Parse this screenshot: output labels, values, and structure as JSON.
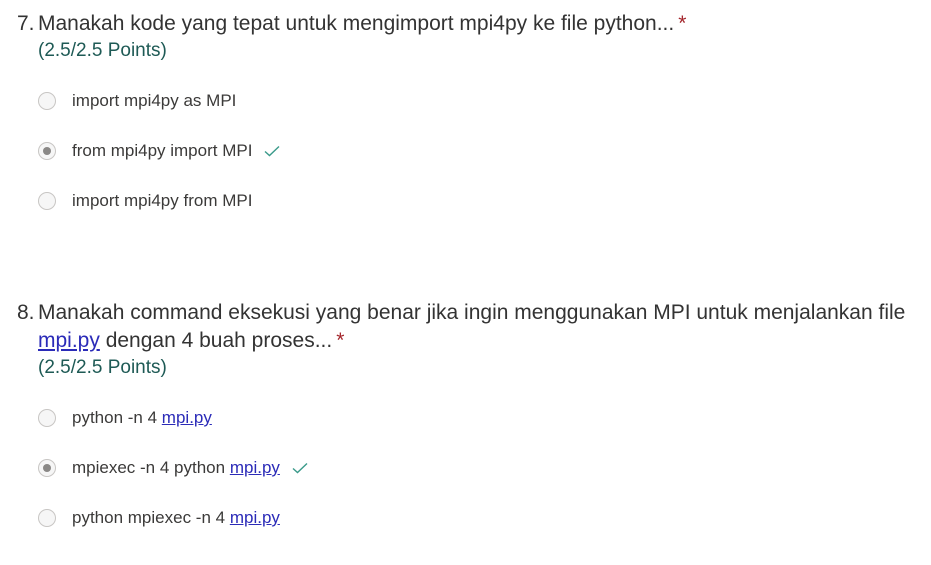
{
  "questions": [
    {
      "number": "7.",
      "text": "Manakah kode yang tepat untuk mengimport mpi4py ke file python...",
      "required_mark": "*",
      "points": "(2.5/2.5 Points)",
      "options": [
        {
          "label": "import mpi4py as MPI",
          "selected": false,
          "correct": false
        },
        {
          "label": "from mpi4py import MPI",
          "selected": true,
          "correct": true
        },
        {
          "label": "import mpi4py from MPI",
          "selected": false,
          "correct": false
        }
      ]
    },
    {
      "number": "8.",
      "text_before": "Manakah command eksekusi yang benar jika ingin menggunakan MPI untuk menjalankan file",
      "link": "mpi.py",
      "text_after": "dengan 4 buah proses...",
      "required_mark": "*",
      "points": "(2.5/2.5 Points)",
      "options": [
        {
          "prefix": "python -n 4",
          "link": "mpi.py",
          "selected": false,
          "correct": false
        },
        {
          "prefix": "mpiexec -n 4 python",
          "link": "mpi.py",
          "selected": true,
          "correct": true
        },
        {
          "prefix": "python mpiexec -n 4",
          "link": "mpi.py",
          "selected": false,
          "correct": false
        }
      ]
    }
  ],
  "colors": {
    "required": "#a4262c",
    "points": "#1e5a55",
    "check": "#3a9a8a",
    "link": "#2b2bb8"
  },
  "icons": {
    "correct": "check-icon"
  }
}
